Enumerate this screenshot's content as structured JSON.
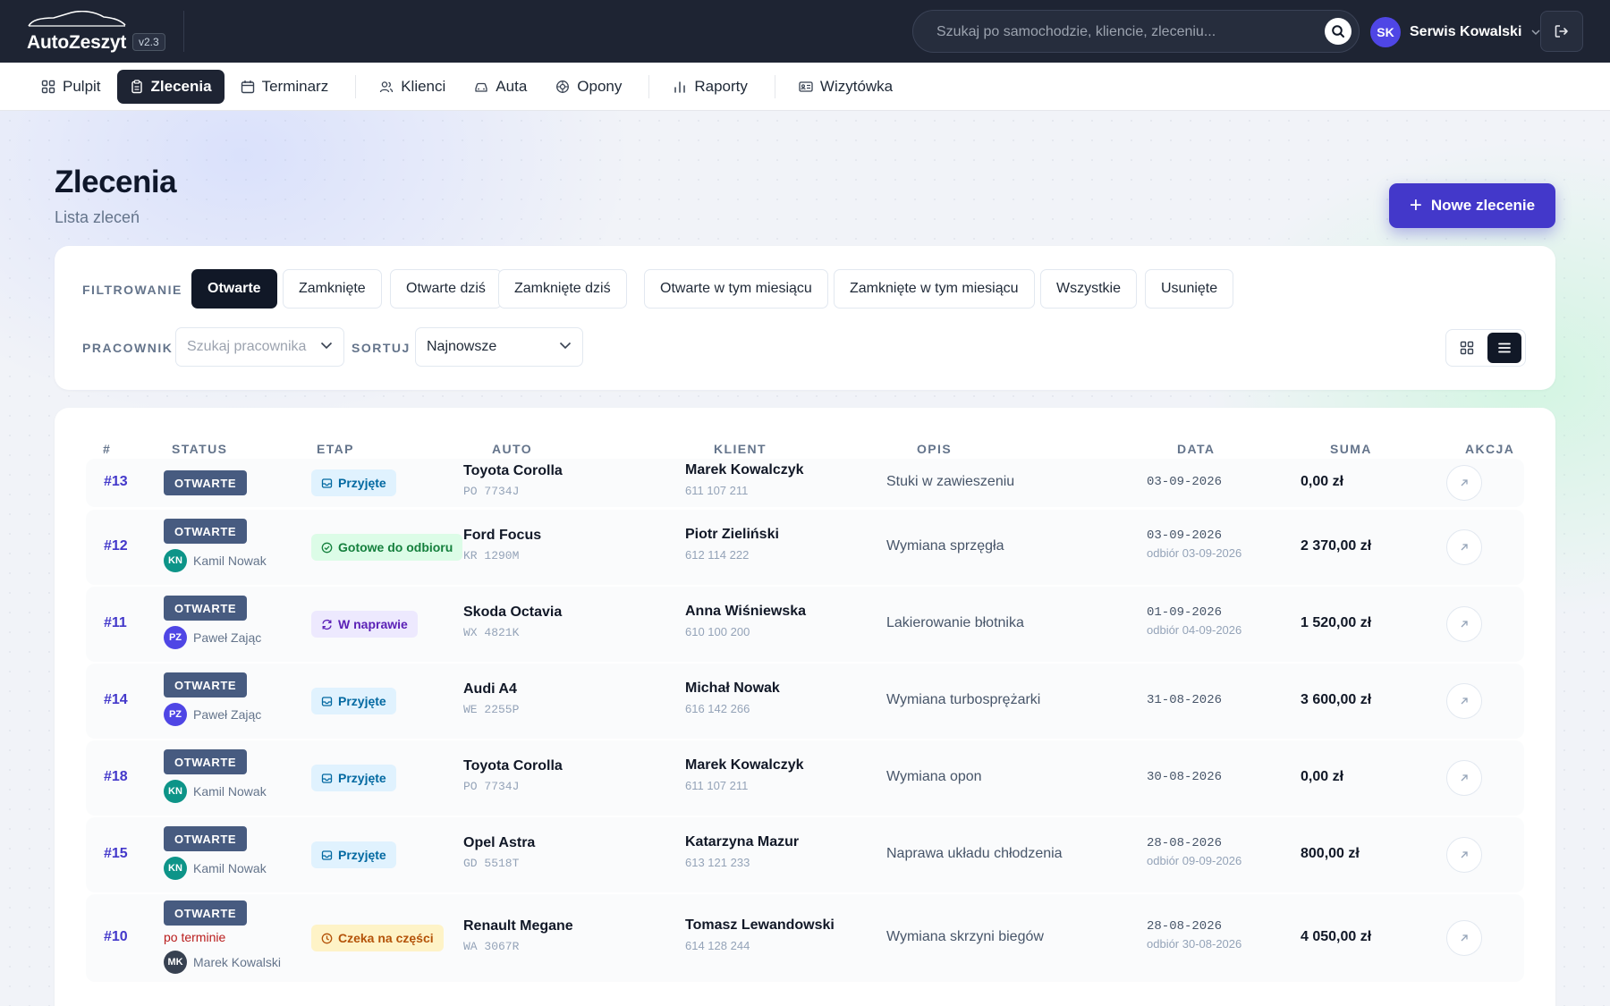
{
  "app": {
    "name": "AutoZeszyt",
    "version": "v2.3"
  },
  "search": {
    "placeholder": "Szukaj po samochodzie, kliencie, zleceniu..."
  },
  "user": {
    "initials": "SK",
    "name": "Serwis Kowalski"
  },
  "nav": [
    {
      "label": "Pulpit",
      "icon": "dashboard-icon"
    },
    {
      "label": "Zlecenia",
      "icon": "clipboard-icon",
      "active": true
    },
    {
      "label": "Terminarz",
      "icon": "calendar-icon"
    },
    {
      "label": "Klienci",
      "icon": "users-icon"
    },
    {
      "label": "Auta",
      "icon": "car-icon"
    },
    {
      "label": "Opony",
      "icon": "tire-icon"
    },
    {
      "label": "Raporty",
      "icon": "bar-chart-icon"
    },
    {
      "label": "Wizytówka",
      "icon": "id-card-icon"
    }
  ],
  "page": {
    "title": "Zlecenia",
    "subtitle": "Lista zleceń",
    "new_button": "Nowe zlecenie"
  },
  "filters": {
    "label": "FILTROWANIE",
    "chips": [
      "Otwarte",
      "Zamknięte",
      "Otwarte dziś",
      "Zamknięte dziś",
      "Otwarte w tym miesiącu",
      "Zamknięte w tym miesiącu",
      "Wszystkie",
      "Usunięte"
    ],
    "active": "Otwarte",
    "worker_label": "PRACOWNIK",
    "worker_placeholder": "Szukaj pracownika",
    "sort_label": "SORTUJ",
    "sort_value": "Najnowsze"
  },
  "table": {
    "headers": [
      "#",
      "STATUS",
      "ETAP",
      "AUTO",
      "KLIENT",
      "OPIS",
      "DATA",
      "SUMA",
      "AKCJA"
    ],
    "rows": [
      {
        "id": "#13",
        "status": "OTWARTE",
        "overdue": "",
        "assignee": "",
        "initials": "",
        "stage": "Przyjęte",
        "stage_type": "received",
        "car": "Toyota Corolla",
        "plate": "PO 7734J",
        "client": "Marek Kowalczyk",
        "phone": "611 107 211",
        "desc": "Stuki w zawieszeniu",
        "date": "03-09-2026",
        "pickup": "",
        "sum": "0,00 zł"
      },
      {
        "id": "#12",
        "status": "OTWARTE",
        "overdue": "",
        "assignee": "Kamil Nowak",
        "initials": "KN",
        "stage": "Gotowe do odbioru",
        "stage_type": "ready",
        "car": "Ford Focus",
        "plate": "KR 1290M",
        "client": "Piotr Zieliński",
        "phone": "612 114 222",
        "desc": "Wymiana sprzęgła",
        "date": "03-09-2026",
        "pickup": "odbiór 03-09-2026",
        "sum": "2 370,00 zł"
      },
      {
        "id": "#11",
        "status": "OTWARTE",
        "overdue": "",
        "assignee": "Paweł Zając",
        "initials": "PZ",
        "stage": "W naprawie",
        "stage_type": "repair",
        "car": "Skoda Octavia",
        "plate": "WX 4821K",
        "client": "Anna Wiśniewska",
        "phone": "610 100 200",
        "desc": "Lakierowanie błotnika",
        "date": "01-09-2026",
        "pickup": "odbiór 04-09-2026",
        "sum": "1 520,00 zł"
      },
      {
        "id": "#14",
        "status": "OTWARTE",
        "overdue": "",
        "assignee": "Paweł Zając",
        "initials": "PZ",
        "stage": "Przyjęte",
        "stage_type": "received",
        "car": "Audi A4",
        "plate": "WE 2255P",
        "client": "Michał Nowak",
        "phone": "616 142 266",
        "desc": "Wymiana turbosprężarki",
        "date": "31-08-2026",
        "pickup": "",
        "sum": "3 600,00 zł"
      },
      {
        "id": "#18",
        "status": "OTWARTE",
        "overdue": "",
        "assignee": "Kamil Nowak",
        "initials": "KN",
        "stage": "Przyjęte",
        "stage_type": "received",
        "car": "Toyota Corolla",
        "plate": "PO 7734J",
        "client": "Marek Kowalczyk",
        "phone": "611 107 211",
        "desc": "Wymiana opon",
        "date": "30-08-2026",
        "pickup": "",
        "sum": "0,00 zł"
      },
      {
        "id": "#15",
        "status": "OTWARTE",
        "overdue": "",
        "assignee": "Kamil Nowak",
        "initials": "KN",
        "stage": "Przyjęte",
        "stage_type": "received",
        "car": "Opel Astra",
        "plate": "GD 5518T",
        "client": "Katarzyna Mazur",
        "phone": "613 121 233",
        "desc": "Naprawa układu chłodzenia",
        "date": "28-08-2026",
        "pickup": "odbiór 09-09-2026",
        "sum": "800,00 zł"
      },
      {
        "id": "#10",
        "status": "OTWARTE",
        "overdue": "po terminie",
        "assignee": "Marek Kowalski",
        "initials": "MK",
        "stage": "Czeka na części",
        "stage_type": "parts",
        "car": "Renault Megane",
        "plate": "WA 3067R",
        "client": "Tomasz Lewandowski",
        "phone": "614 128 244",
        "desc": "Wymiana skrzyni biegów",
        "date": "28-08-2026",
        "pickup": "odbiór 30-08-2026",
        "sum": "4 050,00 zł"
      }
    ]
  },
  "colors": {
    "accent": "#4338ca",
    "dark": "#1e2433",
    "status_badge": "#475b80",
    "avatar_KN": "#0d9488",
    "avatar_PZ": "#4f46e5",
    "avatar_MK": "#374151"
  }
}
